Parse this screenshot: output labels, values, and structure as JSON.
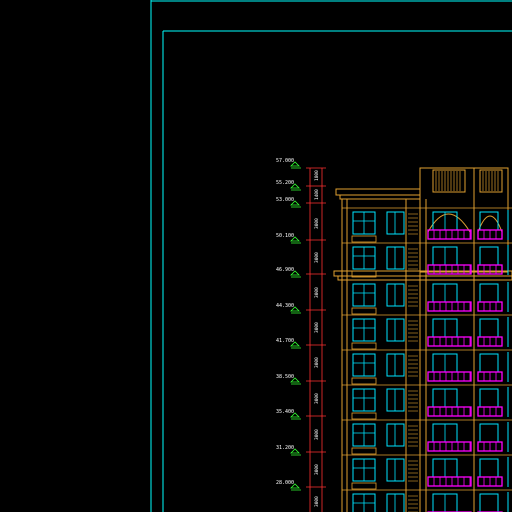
{
  "drawing": {
    "colors": {
      "background": "#000000",
      "border": "#00ffff",
      "outline": "#e0a030",
      "window": "#00e5ff",
      "balcony": "#ff00ff",
      "marker": "#33ff33",
      "dimension_line": "#ff3030",
      "text": "#ffffff"
    },
    "level_labels": [
      "57.000",
      "55.200",
      "53.000",
      "50.100",
      "46.900",
      "44.300",
      "41.700",
      "38.500",
      "35.400",
      "31.200",
      "28.000"
    ],
    "dimension_labels": [
      "1800",
      "1400",
      "3000",
      "3000",
      "3000",
      "3000",
      "3000",
      "3000",
      "3000",
      "3000",
      "3000"
    ]
  }
}
